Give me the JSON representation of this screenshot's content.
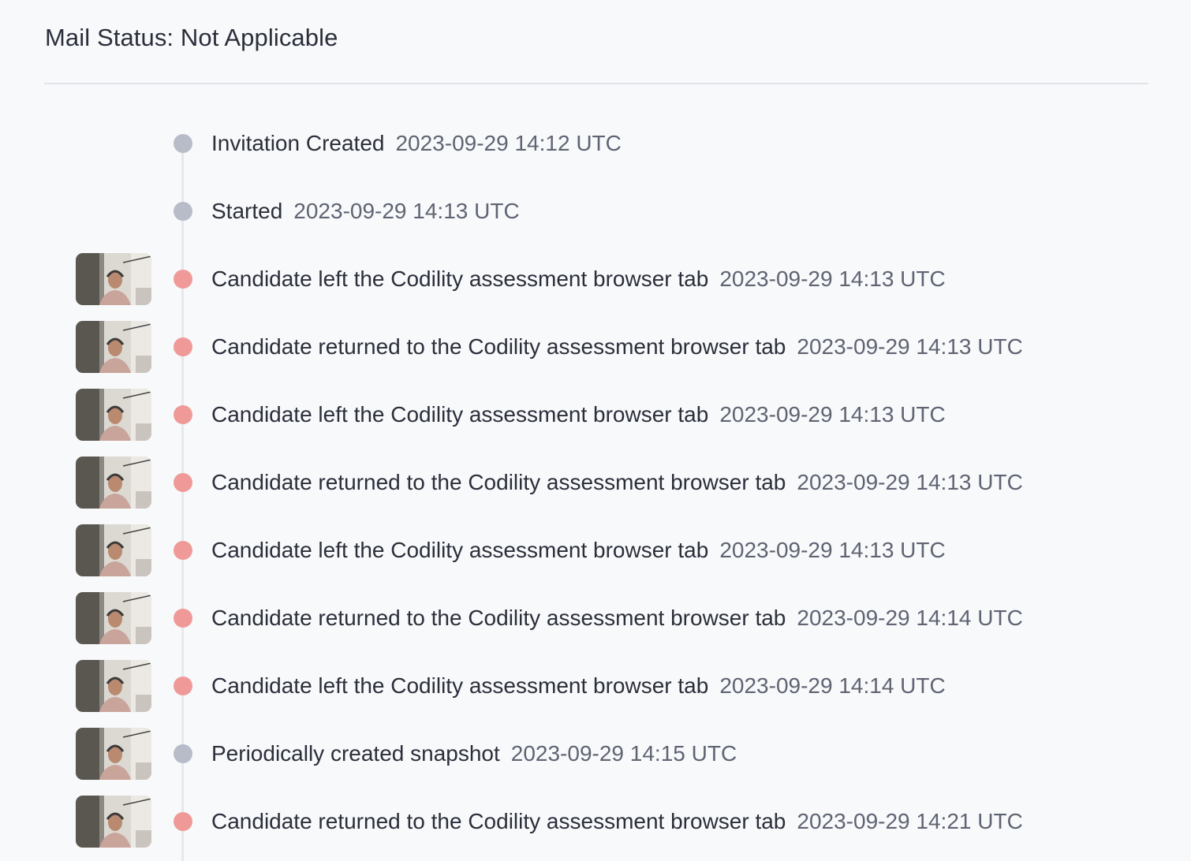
{
  "mail_status": "Mail Status: Not Applicable",
  "events": [
    {
      "title": "Invitation Created",
      "time": "2023-09-29 14:12 UTC",
      "status": "neutral",
      "snapshot": false
    },
    {
      "title": "Started",
      "time": "2023-09-29 14:13 UTC",
      "status": "neutral",
      "snapshot": false
    },
    {
      "title": "Candidate left the Codility assessment browser tab",
      "time": "2023-09-29 14:13 UTC",
      "status": "alert",
      "snapshot": true
    },
    {
      "title": "Candidate returned to the Codility assessment browser tab",
      "time": "2023-09-29 14:13 UTC",
      "status": "alert",
      "snapshot": true
    },
    {
      "title": "Candidate left the Codility assessment browser tab",
      "time": "2023-09-29 14:13 UTC",
      "status": "alert",
      "snapshot": true
    },
    {
      "title": "Candidate returned to the Codility assessment browser tab",
      "time": "2023-09-29 14:13 UTC",
      "status": "alert",
      "snapshot": true
    },
    {
      "title": "Candidate left the Codility assessment browser tab",
      "time": "2023-09-29 14:13 UTC",
      "status": "alert",
      "snapshot": true
    },
    {
      "title": "Candidate returned to the Codility assessment browser tab",
      "time": "2023-09-29 14:14 UTC",
      "status": "alert",
      "snapshot": true
    },
    {
      "title": "Candidate left the Codility assessment browser tab",
      "time": "2023-09-29 14:14 UTC",
      "status": "alert",
      "snapshot": true
    },
    {
      "title": "Periodically created snapshot",
      "time": "2023-09-29 14:15 UTC",
      "status": "neutral",
      "snapshot": true
    },
    {
      "title": "Candidate returned to the Codility assessment browser tab",
      "time": "2023-09-29 14:21 UTC",
      "status": "alert",
      "snapshot": true
    }
  ],
  "colors": {
    "neutral_dot": "#b7bcc8",
    "alert_dot": "#ef9a98"
  }
}
